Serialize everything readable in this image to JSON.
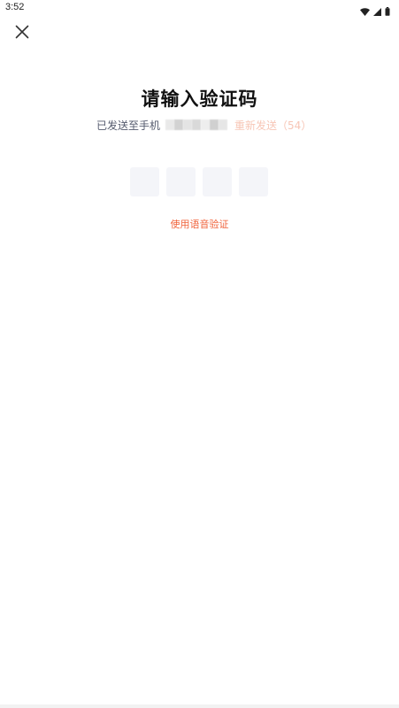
{
  "status_bar": {
    "time": "3:52",
    "icons": [
      "wifi-icon",
      "signal-icon",
      "battery-icon"
    ]
  },
  "header": {
    "close_icon": "close-icon"
  },
  "main": {
    "title": "请输入验证码",
    "sent_text": "已发送至手机",
    "resend_text": "重新发送（54）",
    "code_digits": [
      "",
      "",
      "",
      ""
    ],
    "voice_link": "使用语音验证"
  },
  "colors": {
    "accent": "#f0643c",
    "resend_disabled": "#f7c6b6",
    "code_box_bg": "#f4f5f9",
    "text_secondary": "#555b6e"
  }
}
